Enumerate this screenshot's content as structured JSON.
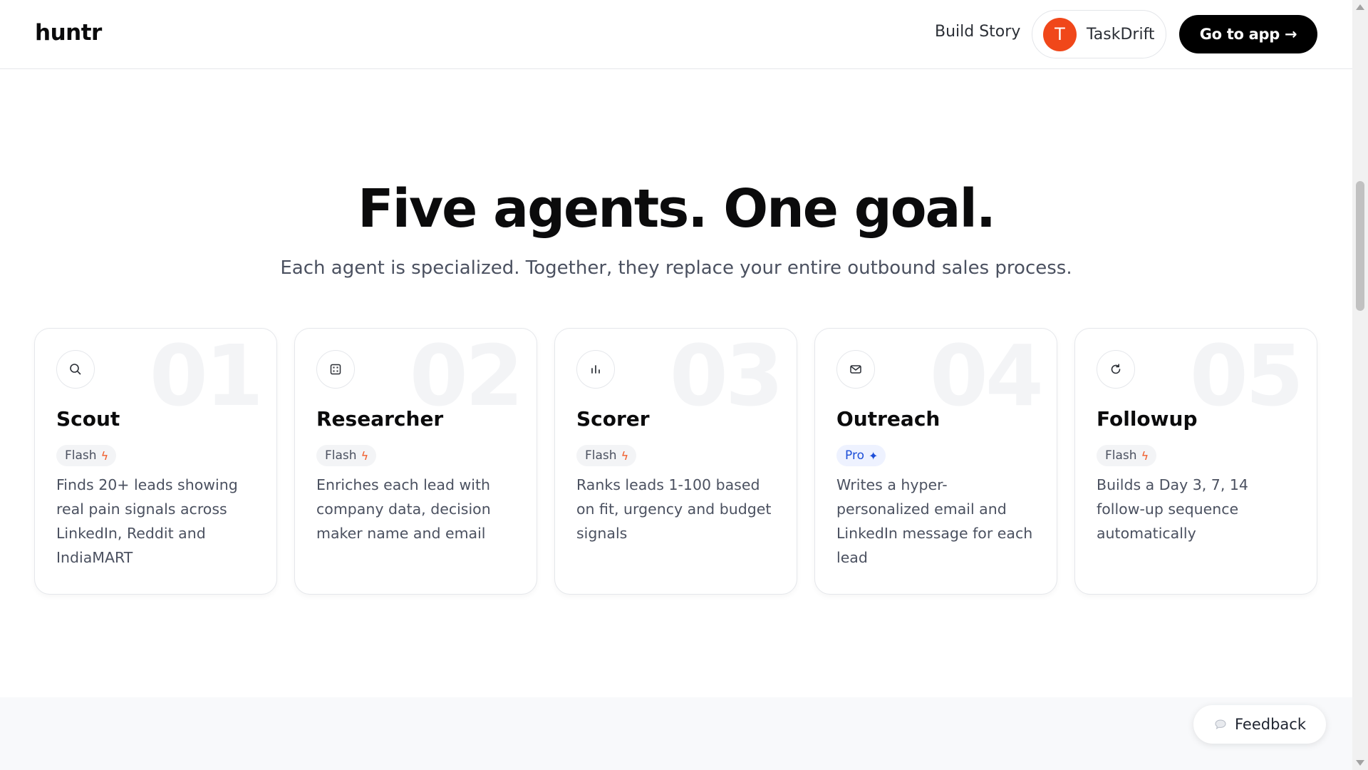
{
  "header": {
    "logo": "huntr",
    "nav_link": "Build Story",
    "user": {
      "initial": "T",
      "name": "TaskDrift",
      "avatar_color": "#f0471a"
    },
    "cta_label": "Go to app →"
  },
  "hero": {
    "title": "Five agents. One goal.",
    "subtitle": "Each agent is specialized. Together, they replace your entire outbound sales process."
  },
  "agents": [
    {
      "num": "01",
      "icon": "search-icon",
      "title": "Scout",
      "badge": "Flash",
      "badge_glyph": "ϟ",
      "tier": "flash",
      "desc": "Finds 20+ leads showing real pain signals across LinkedIn, Reddit and IndiaMART"
    },
    {
      "num": "02",
      "icon": "building-icon",
      "title": "Researcher",
      "badge": "Flash",
      "badge_glyph": "ϟ",
      "tier": "flash",
      "desc": "Enriches each lead with company data, decision maker name and email"
    },
    {
      "num": "03",
      "icon": "bar-chart-icon",
      "title": "Scorer",
      "badge": "Flash",
      "badge_glyph": "ϟ",
      "tier": "flash",
      "desc": "Ranks leads 1-100 based on fit, urgency and budget signals"
    },
    {
      "num": "04",
      "icon": "mail-icon",
      "title": "Outreach",
      "badge": "Pro",
      "badge_glyph": "✦",
      "tier": "pro",
      "desc": "Writes a hyper-personalized email and LinkedIn message for each lead"
    },
    {
      "num": "05",
      "icon": "refresh-icon",
      "title": "Followup",
      "badge": "Flash",
      "badge_glyph": "ϟ",
      "tier": "flash",
      "desc": "Builds a Day 3, 7, 14 follow-up sequence automatically"
    }
  ],
  "feedback": {
    "label": "Feedback",
    "icon": "chat-bubble-icon"
  },
  "colors": {
    "flash_accent": "#f05a28",
    "pro_accent": "#1d4ed8",
    "cta_bg": "#000000"
  }
}
